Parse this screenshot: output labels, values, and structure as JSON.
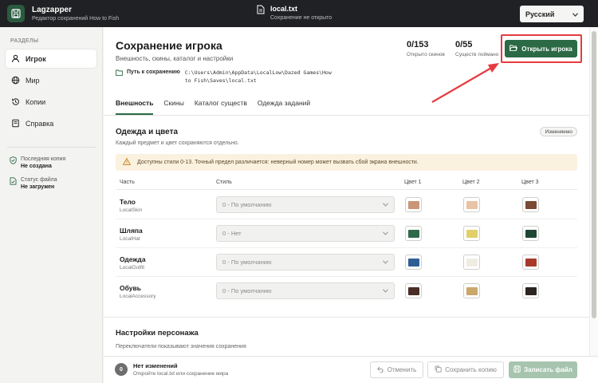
{
  "app": {
    "title": "Lagzapper",
    "subtitle": "Редактор сохранений How to Fish"
  },
  "file": {
    "name": "local.txt",
    "status": "Сохранение не открыто"
  },
  "language": {
    "selected": "Русский"
  },
  "sidebar": {
    "heading": "РАЗДЕЛЫ",
    "items": [
      {
        "label": "Игрок",
        "icon": "user-icon",
        "active": true
      },
      {
        "label": "Мир",
        "icon": "globe-icon",
        "active": false
      },
      {
        "label": "Копии",
        "icon": "history-icon",
        "active": false
      },
      {
        "label": "Справка",
        "icon": "book-icon",
        "active": false
      }
    ],
    "status": [
      {
        "label": "Последняя копия",
        "value": "Не создана",
        "icon": "shield-check-icon"
      },
      {
        "label": "Статус файла",
        "value": "Не загружен",
        "icon": "file-check-icon"
      }
    ]
  },
  "page": {
    "title": "Сохранение игрока",
    "subtitle": "Внешность, скины, каталог и настройки",
    "save_path_label": "Путь к сохранению",
    "save_path_value": "C:\\Users\\Admin\\AppData\\LocalLow\\Dazed Games\\How to Fish\\Saves\\local.txt",
    "stats": [
      {
        "value": "0/153",
        "label": "Открыто скинов"
      },
      {
        "value": "0/55",
        "label": "Существ поймано"
      }
    ],
    "open_button": "Открыть игрока"
  },
  "tabs": [
    {
      "label": "Внешность",
      "active": true
    },
    {
      "label": "Скины",
      "active": false
    },
    {
      "label": "Каталог существ",
      "active": false
    },
    {
      "label": "Одежда заданий",
      "active": false
    }
  ],
  "appearance": {
    "title": "Одежда и цвета",
    "subtitle": "Каждый предмет и цвет сохраняются отдельно.",
    "badge": "Изменяемо",
    "warning": "Доступны стили 0-13. Точный предел различается: неверный номер может вызвать сбой экрана внешности.",
    "columns": {
      "part": "Часть",
      "style": "Стиль",
      "color1": "Цвет 1",
      "color2": "Цвет 2",
      "color3": "Цвет 3"
    },
    "rows": [
      {
        "name": "Тело",
        "key": "LocalSkin",
        "style": "0 - По умолчанию",
        "colors": [
          "#c9967a",
          "#e8c3a4",
          "#7a4a34"
        ]
      },
      {
        "name": "Шляпа",
        "key": "LocalHat",
        "style": "0 - Нет",
        "colors": [
          "#2e6a4a",
          "#e2cf6a",
          "#1f4633"
        ]
      },
      {
        "name": "Одежда",
        "key": "LocalOutfit",
        "style": "0 - По умолчанию",
        "colors": [
          "#2f5e96",
          "#efede2",
          "#a93a2b"
        ]
      },
      {
        "name": "Обувь",
        "key": "LocalAccessory",
        "style": "0 - По умолчанию",
        "colors": [
          "#4a2e25",
          "#c9a86a",
          "#2b2422"
        ]
      }
    ]
  },
  "character": {
    "title": "Настройки персонажа",
    "subtitle": "Переключатели показывают значения сохранения"
  },
  "footer": {
    "badge": "0",
    "title": "Нет изменений",
    "subtitle": "Откройте local.txt или сохранение мира",
    "cancel": "Отменить",
    "save_copy": "Сохранить копию",
    "write_file": "Записать файл"
  },
  "colors": {
    "accent": "#2b6a45",
    "topbar": "#202124",
    "highlight": "#e63b3f",
    "warning_bg": "#fbf1df"
  }
}
